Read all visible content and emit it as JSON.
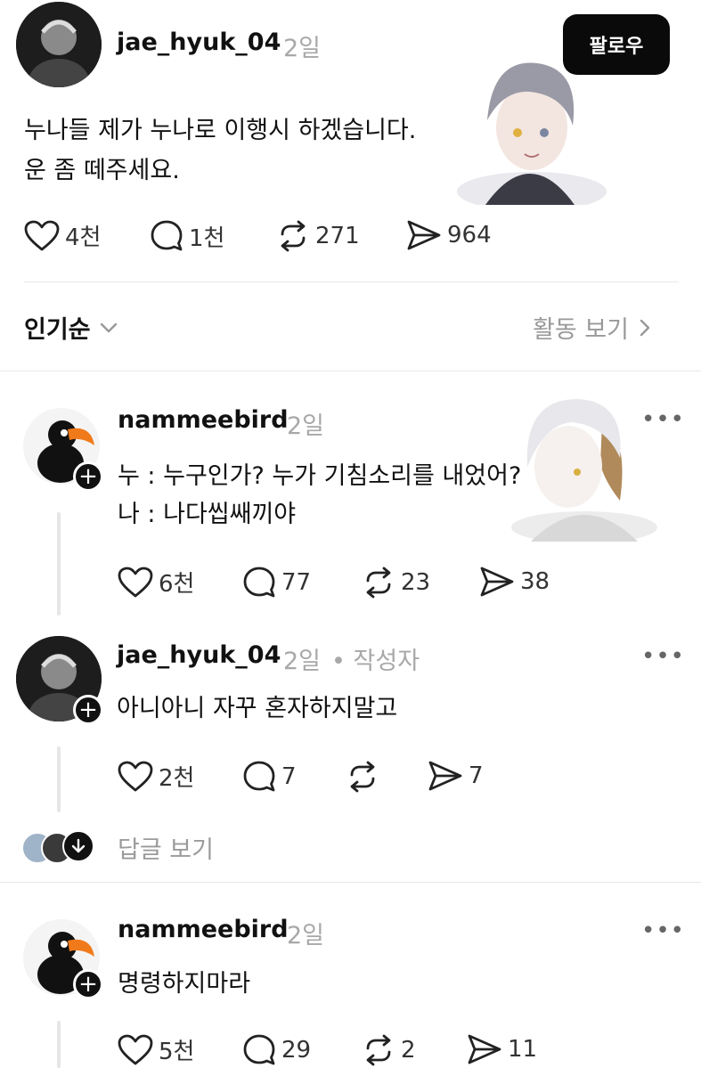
{
  "post": {
    "username": "jae_hyuk_04",
    "time": "2일",
    "follow_label": "팔로우",
    "text_lines": [
      "누나들 제가 누나로 이행시 하겠습니다.",
      "운 좀 떼주세요."
    ],
    "likes": "4천",
    "comments": "1천",
    "reposts": "271",
    "shares": "964"
  },
  "sort": {
    "label": "인기순",
    "activity_label": "활동 보기"
  },
  "replies": [
    {
      "username": "nammeebird",
      "time": "2일",
      "author_tag": "",
      "text_lines": [
        "누 : 누구인가? 누가 기침소리를 내었어?",
        "나 : 나다씹쌔끼야"
      ],
      "likes": "6천",
      "comments": "77",
      "reposts": "23",
      "shares": "38"
    },
    {
      "username": "jae_hyuk_04",
      "time": "2일",
      "author_tag": "• 작성자",
      "text_lines": [
        "아니아니 자꾸 혼자하지말고"
      ],
      "likes": "2천",
      "comments": "7",
      "reposts": "",
      "shares": "7",
      "view_replies_label": "답글 보기"
    },
    {
      "username": "nammeebird",
      "time": "2일",
      "author_tag": "",
      "text_lines": [
        "명령하지마라"
      ],
      "likes": "5천",
      "comments": "29",
      "reposts": "2",
      "shares": "11"
    }
  ],
  "icons": {
    "like": "heart-icon",
    "comment": "speech-bubble-icon",
    "repost": "repost-icon",
    "share": "send-icon",
    "more": "more-dots-icon",
    "chevron": "chevron-down-icon",
    "chevron_right": "chevron-right-icon",
    "plus": "plus-icon",
    "down_arrow": "arrow-down-icon"
  },
  "colors": {
    "text": "#111111",
    "muted": "#a8a8a8",
    "follow_bg": "#0a0a0a",
    "divider": "#e8e8e8"
  }
}
